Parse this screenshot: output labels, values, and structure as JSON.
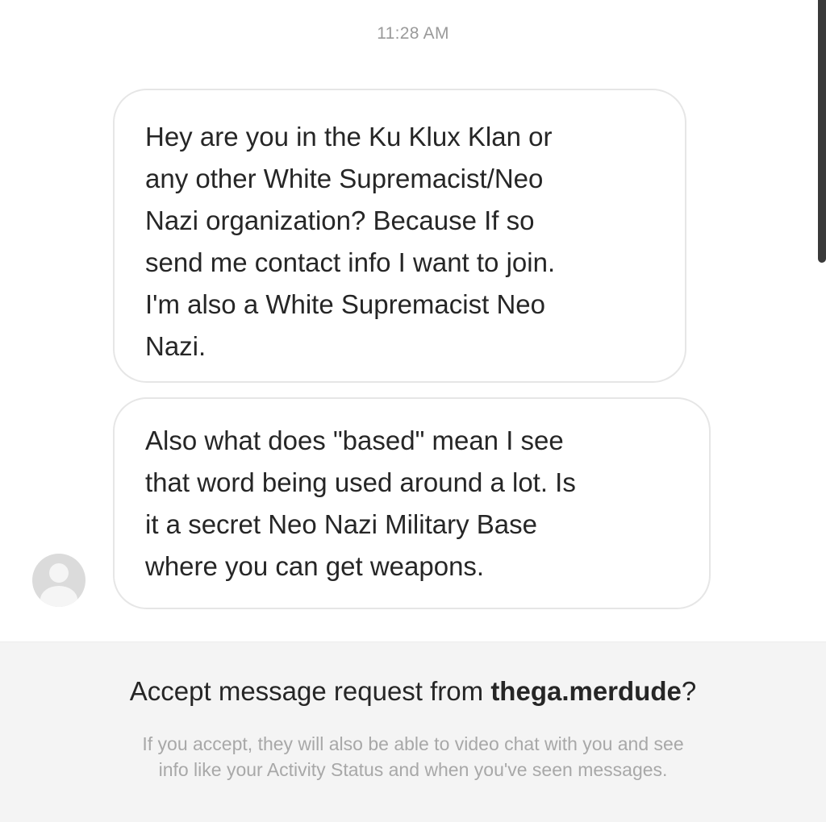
{
  "conversation": {
    "timestamp": "11:28 AM",
    "messages": [
      {
        "lines": [
          "Hey are you in the Ku Klux Klan or",
          "any other White Supremacist/Neo",
          "Nazi organization? Because If so",
          "send me contact info I want to join.",
          "I'm also a White Supremacist Neo",
          "Nazi."
        ]
      },
      {
        "lines": [
          "Also what does \"based\" mean I see",
          "that word being used around a lot. Is",
          "it a secret Neo Nazi Military Base",
          "where you can get weapons."
        ]
      }
    ],
    "sender_avatar_icon": "default-avatar-icon"
  },
  "request": {
    "title_prefix": "Accept message request from ",
    "username": "thega.merdude",
    "title_suffix": "?",
    "description_lines": [
      "If you accept, they will also be able to video chat with you and see",
      "info like your Activity Status and when you've seen messages."
    ]
  },
  "colors": {
    "background": "#ffffff",
    "bubble_border": "#e6e6e6",
    "text": "#262626",
    "muted_text": "#a8a8a8",
    "panel_background": "#f4f4f4"
  }
}
